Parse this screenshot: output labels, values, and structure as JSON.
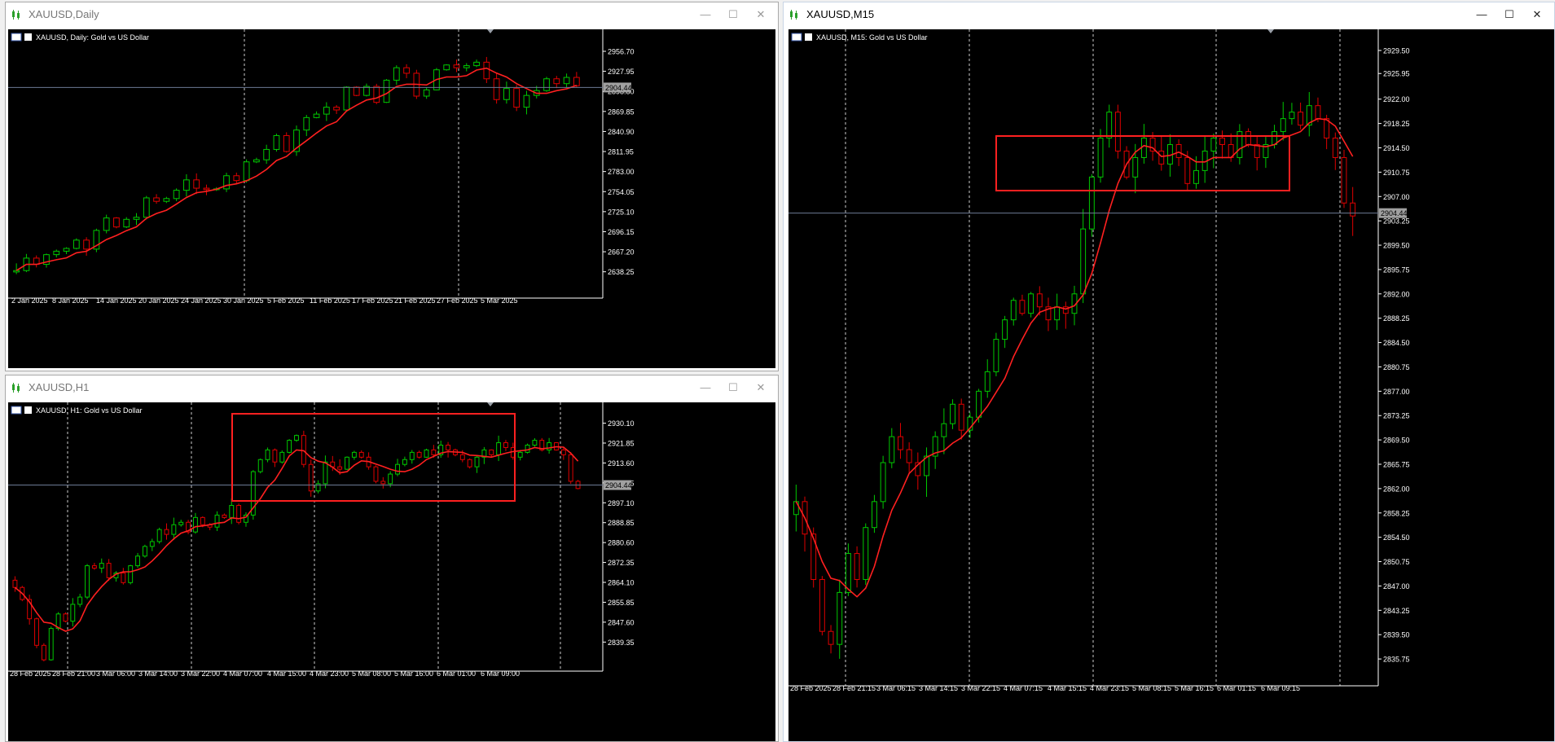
{
  "windows": [
    {
      "title": "XAUUSD,Daily",
      "chart_label": "XAUUSD, Daily:  Gold vs US Dollar",
      "price_tag": "2904.44"
    },
    {
      "title": "XAUUSD,H1",
      "chart_label": "XAUUSD, H1:  Gold vs US Dollar",
      "price_tag": "2904.44"
    },
    {
      "title": "XAUUSD,M15",
      "chart_label": "XAUUSD, M15:  Gold vs US Dollar",
      "price_tag": "2904.44"
    }
  ],
  "window_buttons": {
    "minimize": "—",
    "maximize": "☐",
    "close": "✕"
  },
  "colors": {
    "bull": "#00c800",
    "bear": "#e00000",
    "ma": "#ff2020",
    "grid": "#ffffff",
    "axis_text": "#ffffff",
    "highlight_box": "#ff2020",
    "price_line": "#6c7a94",
    "tag_bg": "#a0a0a0"
  },
  "icons": {
    "chart_icon": "candlestick-chart-icon",
    "flag_icon": "flag-icon",
    "menu_icon": "chart-menu-icon"
  },
  "chart_data": [
    {
      "type": "candlestick",
      "timeframe": "Daily",
      "title": "XAUUSD, Daily:  Gold vs US Dollar",
      "current_price": 2904.44,
      "ylim": [
        2612,
        2972
      ],
      "y_ticks": [
        "2956.70",
        "2927.95",
        "2898.80",
        "2869.85",
        "2840.90",
        "2811.95",
        "2783.00",
        "2754.05",
        "2725.10",
        "2696.15",
        "2667.20",
        "2638.25"
      ],
      "x_labels": [
        "2 Jan 2025",
        "8 Jan 2025",
        "14 Jan 2025",
        "20 Jan 2025",
        "24 Jan 2025",
        "30 Jan 2025",
        "5 Feb 2025",
        "11 Feb 2025",
        "17 Feb 2025",
        "21 Feb 2025",
        "27 Feb 2025",
        "5 Mar 2025"
      ],
      "grid_x_labels": [
        "30 Jan 2025",
        "27 Feb 2025"
      ],
      "close_series": [
        2640,
        2658,
        2649,
        2663,
        2668,
        2672,
        2684,
        2671,
        2698,
        2716,
        2703,
        2714,
        2717,
        2745,
        2740,
        2744,
        2756,
        2771,
        2759,
        2757,
        2758,
        2777,
        2770,
        2797,
        2800,
        2815,
        2835,
        2812,
        2843,
        2861,
        2866,
        2876,
        2872,
        2905,
        2893,
        2906,
        2883,
        2915,
        2933,
        2925,
        2892,
        2901,
        2930,
        2937,
        2933,
        2936,
        2941,
        2917,
        2887,
        2903,
        2876,
        2893,
        2900,
        2917,
        2910,
        2919,
        2907
      ]
    },
    {
      "type": "candlestick",
      "timeframe": "H1",
      "title": "XAUUSD, H1:  Gold vs US Dollar",
      "current_price": 2904.44,
      "ylim": [
        2830,
        2934
      ],
      "y_ticks": [
        "2930.10",
        "2921.85",
        "2913.60",
        "2905.35",
        "2897.10",
        "2888.85",
        "2880.60",
        "2872.35",
        "2864.10",
        "2855.85",
        "2847.60",
        "2839.35"
      ],
      "x_labels": [
        "28 Feb 2025",
        "28 Feb 21:00",
        "3 Mar 06:00",
        "3 Mar 14:00",
        "3 Mar 22:00",
        "4 Mar 07:00",
        "4 Mar 15:00",
        "4 Mar 23:00",
        "5 Mar 08:00",
        "5 Mar 16:00",
        "6 Mar 01:00",
        "6 Mar 09:00"
      ],
      "grid_x_labels": [
        "28 Feb 21:00",
        "3 Mar 22:00",
        "4 Mar 23:00",
        "6 Mar 01:00"
      ],
      "highlight_box_price": [
        2896,
        2930
      ],
      "close_series": [
        2862,
        2857,
        2849,
        2838,
        2832,
        2845,
        2851,
        2848,
        2855,
        2858,
        2871,
        2870,
        2872,
        2866,
        2868,
        2864,
        2871,
        2875,
        2879,
        2881,
        2886,
        2884,
        2888,
        2889,
        2885,
        2891,
        2888,
        2887,
        2892,
        2891,
        2896,
        2889,
        2892,
        2910,
        2915,
        2919,
        2914,
        2918,
        2923,
        2925,
        2913,
        2902,
        2905,
        2914,
        2912,
        2911,
        2916,
        2918,
        2916,
        2912,
        2906,
        2905,
        2909,
        2913,
        2915,
        2918,
        2916,
        2919,
        2917,
        2921,
        2919,
        2917,
        2915,
        2912,
        2916,
        2919,
        2917,
        2922,
        2920,
        2916,
        2918,
        2921,
        2923,
        2919,
        2922,
        2919,
        2917,
        2906,
        2903
      ]
    },
    {
      "type": "candlestick",
      "timeframe": "M15",
      "title": "XAUUSD, M15:  Gold vs US Dollar",
      "current_price": 2904.44,
      "ylim": [
        2833,
        2931
      ],
      "y_ticks": [
        "2929.50",
        "2925.95",
        "2922.00",
        "2918.25",
        "2914.50",
        "2910.75",
        "2907.00",
        "2903.25",
        "2899.50",
        "2895.75",
        "2892.00",
        "2888.25",
        "2884.50",
        "2880.75",
        "2877.00",
        "2873.25",
        "2869.50",
        "2865.75",
        "2862.00",
        "2858.25",
        "2854.50",
        "2850.75",
        "2847.00",
        "2843.25",
        "2839.50",
        "2835.75"
      ],
      "x_labels": [
        "28 Feb 2025",
        "28 Feb 21:15",
        "3 Mar 06:15",
        "3 Mar 14:15",
        "3 Mar 22:15",
        "4 Mar 07:15",
        "4 Mar 15:15",
        "4 Mar 23:15",
        "5 Mar 08:15",
        "5 Mar 16:15",
        "6 Mar 01:15",
        "6 Mar 09:15"
      ],
      "grid_x_labels": [
        "28 Feb 21:15",
        "3 Mar 22:15",
        "4 Mar 23:15",
        "6 Mar 01:15"
      ],
      "highlight_box_price": [
        2908,
        2917
      ],
      "close_series": [
        2860,
        2855,
        2848,
        2840,
        2838,
        2846,
        2852,
        2848,
        2856,
        2860,
        2866,
        2870,
        2868,
        2866,
        2864,
        2867,
        2870,
        2872,
        2875,
        2871,
        2873,
        2877,
        2880,
        2885,
        2888,
        2891,
        2889,
        2892,
        2890,
        2888,
        2890,
        2889,
        2892,
        2902,
        2910,
        2916,
        2920,
        2914,
        2910,
        2913,
        2916,
        2914,
        2912,
        2915,
        2913,
        2909,
        2911,
        2914,
        2916,
        2915,
        2913,
        2917,
        2915,
        2913,
        2915,
        2917,
        2919,
        2920,
        2918,
        2921,
        2919,
        2916,
        2913,
        2906,
        2904
      ]
    }
  ]
}
